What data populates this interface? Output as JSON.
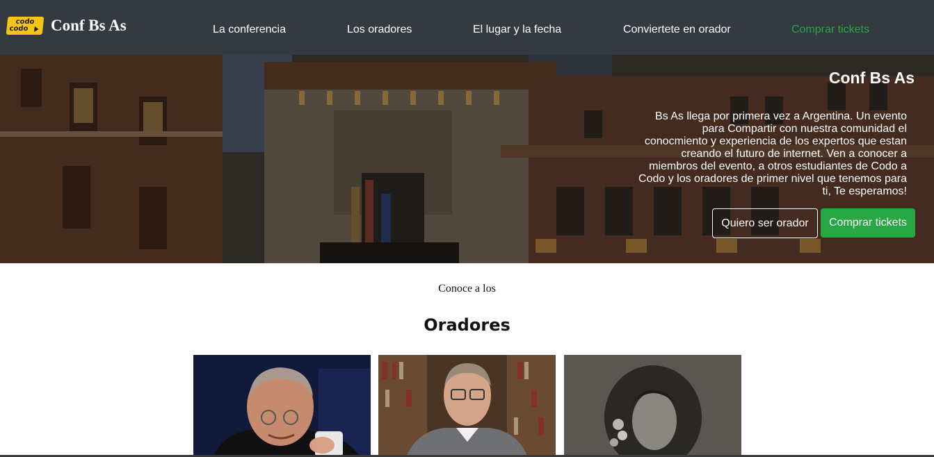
{
  "nav": {
    "brand_logo_line1": "codo",
    "brand_logo_line2": "codo",
    "brand_name": "Conf Bs As",
    "links": [
      {
        "label": "La conferencia"
      },
      {
        "label": "Los oradores"
      },
      {
        "label": "El lugar y la fecha"
      },
      {
        "label": "Conviertete en orador"
      },
      {
        "label": "Comprar tickets"
      }
    ],
    "accent_color": "#28a745"
  },
  "hero": {
    "title": "Conf Bs As",
    "description": "Bs As llega por primera vez a Argentina. Un evento para Compartir con nuestra comunidad el conocmiento y experiencia de los expertos que estan creando el futuro de internet. Ven a conocer a miembros del evento, a otros estudiantes de Codo a Codo y los oradores de primer nivel que tenemos para ti, Te esperamos!",
    "btn_speaker": "Quiero ser orador",
    "btn_tickets": "Comprar tickets"
  },
  "speakers": {
    "subtitle": "Conoce a los",
    "title": "Oradores"
  }
}
